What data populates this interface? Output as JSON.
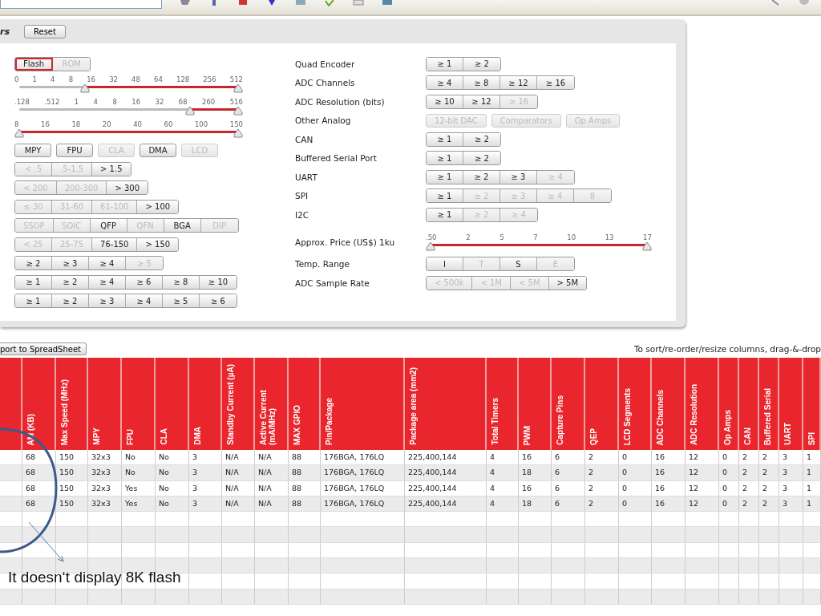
{
  "filters": {
    "title": "rs",
    "reset": "Reset",
    "left": [
      {
        "kind": "toggle",
        "options": [
          {
            "label": "Flash",
            "selected": true
          },
          {
            "label": "ROM",
            "selected": false
          }
        ]
      },
      {
        "kind": "slider",
        "ticks": [
          "0",
          "1",
          "4",
          "8",
          "16",
          "32",
          "48",
          "64",
          "128",
          "256",
          "512"
        ],
        "thumbs": [
          {
            "level": 0.3
          },
          {
            "level": 1
          }
        ]
      },
      {
        "kind": "slider",
        "ticks": [
          ".128",
          ".512",
          "1",
          "4",
          "8",
          "16",
          "32",
          "68",
          "260",
          "516"
        ],
        "thumbs": [
          {
            "level": 0.78
          },
          {
            "level": 1
          }
        ]
      },
      {
        "kind": "slider",
        "ticks": [
          "8",
          "16",
          "18",
          "20",
          "40",
          "60",
          "100",
          "150"
        ],
        "thumbs": [
          {
            "level": 0
          },
          {
            "level": 1
          }
        ]
      },
      {
        "kind": "buttons",
        "options": [
          {
            "label": "MPY",
            "selected": true
          },
          {
            "label": "FPU",
            "selected": true
          },
          {
            "label": "CLA",
            "selected": false
          },
          {
            "label": "DMA",
            "selected": true
          },
          {
            "label": "LCD",
            "selected": false
          }
        ]
      },
      {
        "kind": "segments",
        "options": [
          {
            "label": "< .5",
            "selected": false
          },
          {
            "label": ".5-1.5",
            "selected": false
          },
          {
            "label": "> 1.5",
            "selected": true
          }
        ]
      },
      {
        "kind": "segments",
        "options": [
          {
            "label": "< 200",
            "selected": false
          },
          {
            "label": "200-300",
            "selected": false
          },
          {
            "label": "> 300",
            "selected": true
          }
        ]
      },
      {
        "kind": "segments",
        "options": [
          {
            "label": "≤ 30",
            "selected": false
          },
          {
            "label": "31-60",
            "selected": false
          },
          {
            "label": "61-100",
            "selected": false
          },
          {
            "label": "> 100",
            "selected": true
          }
        ]
      },
      {
        "kind": "segments",
        "options": [
          {
            "label": "SSOP",
            "selected": false
          },
          {
            "label": "SOIC",
            "selected": false
          },
          {
            "label": "QFP",
            "selected": true
          },
          {
            "label": "QFN",
            "selected": false
          },
          {
            "label": "BGA",
            "selected": true
          },
          {
            "label": "DIP",
            "selected": false
          }
        ]
      },
      {
        "kind": "segments",
        "options": [
          {
            "label": "< 25",
            "selected": false
          },
          {
            "label": "25-75",
            "selected": false
          },
          {
            "label": "76-150",
            "selected": true
          },
          {
            "label": "> 150",
            "selected": true
          }
        ]
      },
      {
        "kind": "segments",
        "options": [
          {
            "label": "≥ 2",
            "selected": true
          },
          {
            "label": "≥ 3",
            "selected": true
          },
          {
            "label": "≥ 4",
            "selected": true
          },
          {
            "label": "≥ 5",
            "selected": false
          }
        ]
      },
      {
        "kind": "segments",
        "options": [
          {
            "label": "≥ 1",
            "selected": true
          },
          {
            "label": "≥ 2",
            "selected": true
          },
          {
            "label": "≥ 4",
            "selected": true
          },
          {
            "label": "≥ 6",
            "selected": true
          },
          {
            "label": "≥ 8",
            "selected": true
          },
          {
            "label": "≥ 10",
            "selected": true
          }
        ]
      },
      {
        "kind": "segments",
        "options": [
          {
            "label": "≥ 1",
            "selected": true
          },
          {
            "label": "≥ 2",
            "selected": true
          },
          {
            "label": "≥ 3",
            "selected": true
          },
          {
            "label": "≥ 4",
            "selected": true
          },
          {
            "label": "≥ 5",
            "selected": true
          },
          {
            "label": "≥ 6",
            "selected": true
          }
        ]
      }
    ],
    "right": [
      {
        "label": "Quad Encoder",
        "kind": "segments",
        "options": [
          {
            "label": "≥ 1",
            "selected": true
          },
          {
            "label": "≥ 2",
            "selected": true
          }
        ]
      },
      {
        "label": "ADC Channels",
        "kind": "segments",
        "options": [
          {
            "label": "≥ 4",
            "selected": true
          },
          {
            "label": "≥ 8",
            "selected": true
          },
          {
            "label": "≥ 12",
            "selected": true
          },
          {
            "label": "≥ 16",
            "selected": true
          }
        ]
      },
      {
        "label": "ADC Resolution (bits)",
        "kind": "segments",
        "options": [
          {
            "label": "≥ 10",
            "selected": true
          },
          {
            "label": "≥ 12",
            "selected": true
          },
          {
            "label": "≥ 16",
            "selected": false
          }
        ]
      },
      {
        "label": "Other Analog",
        "kind": "buttons",
        "options": [
          {
            "label": "12-bit DAC",
            "selected": false
          },
          {
            "label": "Comparators",
            "selected": false
          },
          {
            "label": "Op Amps",
            "selected": false
          }
        ]
      },
      {
        "label": "CAN",
        "kind": "segments",
        "options": [
          {
            "label": "≥ 1",
            "selected": true
          },
          {
            "label": "≥ 2",
            "selected": true
          }
        ]
      },
      {
        "label": "Buffered Serial Port",
        "kind": "segments",
        "options": [
          {
            "label": "≥ 1",
            "selected": true
          },
          {
            "label": "≥ 2",
            "selected": true
          }
        ]
      },
      {
        "label": "UART",
        "kind": "segments",
        "options": [
          {
            "label": "≥ 1",
            "selected": true
          },
          {
            "label": "≥ 2",
            "selected": true
          },
          {
            "label": "≥ 3",
            "selected": true
          },
          {
            "label": "≥ 4",
            "selected": false
          }
        ]
      },
      {
        "label": "SPI",
        "kind": "segments",
        "options": [
          {
            "label": "≥ 1",
            "selected": true
          },
          {
            "label": "≥ 2",
            "selected": false
          },
          {
            "label": "≥ 3",
            "selected": false
          },
          {
            "label": "≥ 4",
            "selected": false
          },
          {
            "label": "8",
            "selected": false
          }
        ]
      },
      {
        "label": "I2C",
        "kind": "segments",
        "options": [
          {
            "label": "≥ 1",
            "selected": true
          },
          {
            "label": "≥ 2",
            "selected": false
          },
          {
            "label": "≥ 4",
            "selected": false
          }
        ]
      },
      {
        "label": "Approx. Price (US$) 1ku",
        "kind": "slider",
        "ticks": [
          ".50",
          "2",
          "5",
          "7",
          "10",
          "13",
          "17"
        ],
        "thumbs": [
          {
            "level": 0
          },
          {
            "level": 1
          }
        ]
      },
      {
        "label": "Temp. Range",
        "kind": "segments",
        "options": [
          {
            "label": "I",
            "selected": true
          },
          {
            "label": "T",
            "selected": false
          },
          {
            "label": "S",
            "selected": true
          },
          {
            "label": "E",
            "selected": false
          }
        ]
      },
      {
        "label": "ADC Sample Rate",
        "kind": "segments",
        "options": [
          {
            "label": "< 500k",
            "selected": false
          },
          {
            "label": "< 1M",
            "selected": false
          },
          {
            "label": "< 5M",
            "selected": false
          },
          {
            "label": "> 5M",
            "selected": true
          }
        ]
      }
    ]
  },
  "export_button": "port to SpreadSheet",
  "hint": "To sort/re-order/resize columns, drag-&-drop",
  "table": {
    "columns": [
      "AM (KB)",
      "Max Speed (MHz)",
      "MPY",
      "FPU",
      "CLA",
      "DMA",
      "Standby Current (µA)",
      "Active Current (mA/MHz)",
      "MAX GPIO",
      "Pin/Package",
      "Package area (mm2)",
      "Total Timers",
      "PWM",
      "Capture Pins",
      "QEP",
      "LCD Segments",
      "ADC Channels",
      "ADC Resolution",
      "Op Amps",
      "CAN",
      "Buffered Serial",
      "UART",
      "SPI"
    ],
    "rows": [
      [
        "68",
        "150",
        "32x3",
        "No",
        "No",
        "3",
        "N/A",
        "N/A",
        "88",
        "176BGA, 176LQ",
        "225,400,144",
        "4",
        "16",
        "6",
        "2",
        "0",
        "16",
        "12",
        "0",
        "2",
        "2",
        "3",
        "1"
      ],
      [
        "68",
        "150",
        "32x3",
        "No",
        "No",
        "3",
        "N/A",
        "N/A",
        "88",
        "176BGA, 176LQ",
        "225,400,144",
        "4",
        "18",
        "6",
        "2",
        "0",
        "16",
        "12",
        "0",
        "2",
        "2",
        "3",
        "1"
      ],
      [
        "68",
        "150",
        "32x3",
        "Yes",
        "No",
        "3",
        "N/A",
        "N/A",
        "88",
        "176BGA, 176LQ",
        "225,400,144",
        "4",
        "16",
        "6",
        "2",
        "0",
        "16",
        "12",
        "0",
        "2",
        "2",
        "3",
        "1"
      ],
      [
        "68",
        "150",
        "32x3",
        "Yes",
        "No",
        "3",
        "N/A",
        "N/A",
        "88",
        "176BGA, 176LQ",
        "225,400,144",
        "4",
        "18",
        "6",
        "2",
        "0",
        "16",
        "12",
        "0",
        "2",
        "2",
        "3",
        "1"
      ]
    ]
  },
  "annotation": {
    "text": "It doesn‘t display 8K flash"
  }
}
